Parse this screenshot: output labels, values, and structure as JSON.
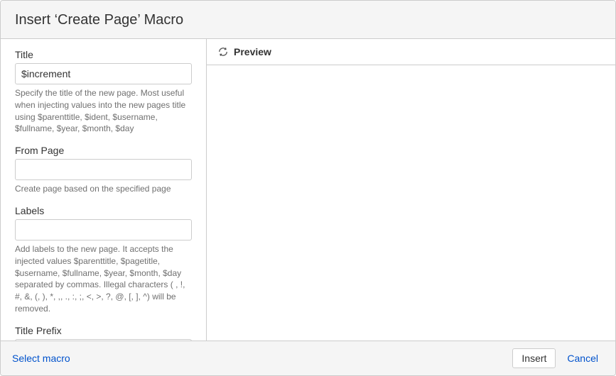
{
  "dialog": {
    "title": "Insert ‘Create Page’ Macro"
  },
  "form": {
    "title": {
      "label": "Title",
      "value": "$increment",
      "help": "Specify the title of the new page. Most useful when injecting values into the new pages title using $parenttitle, $ident, $username, $fullname, $year, $month, $day"
    },
    "from_page": {
      "label": "From Page",
      "value": "",
      "help": "Create page based on the specified page"
    },
    "labels": {
      "label": "Labels",
      "value": "",
      "help": "Add labels to the new page. It accepts the injected values $parenttitle, $pagetitle, $username, $fullname, $year, $month, $day separated by commas. Illegal characters ( , !, #, &, (, ), *, ,, ., :, ;, <, >, ?, @, [, ], ^) will be removed."
    },
    "title_prefix": {
      "label": "Title Prefix",
      "value": ""
    }
  },
  "preview": {
    "label": "Preview"
  },
  "footer": {
    "select_macro": "Select macro",
    "insert": "Insert",
    "cancel": "Cancel"
  }
}
